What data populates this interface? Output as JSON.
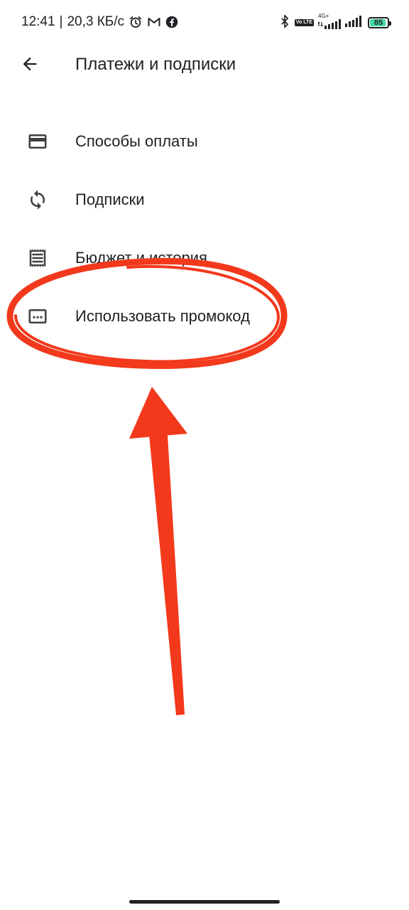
{
  "status_bar": {
    "time": "12:41",
    "separator": "|",
    "net_speed": "20,3 КБ/с",
    "network_type": "4G+",
    "volte": "Vo LTE",
    "battery_level": "85",
    "icons_left": [
      "alarm-icon",
      "gmail-icon",
      "facebook-icon"
    ],
    "icons_right": [
      "bluetooth-icon",
      "volte-icon",
      "signal-icon",
      "signal-icon"
    ]
  },
  "app_bar": {
    "back_icon": "arrow-back-icon",
    "title": "Платежи и подписки"
  },
  "menu": {
    "items": [
      {
        "icon": "credit-card-icon",
        "label": "Способы оплаты"
      },
      {
        "icon": "sync-icon",
        "label": "Подписки"
      },
      {
        "icon": "receipt-icon",
        "label": "Бюджет и история"
      },
      {
        "icon": "promo-code-icon",
        "label": "Использовать промокод"
      }
    ]
  },
  "annotation": {
    "color": "#f2391c",
    "shapes": [
      "ellipse",
      "arrow"
    ]
  },
  "colors": {
    "text": "#202124",
    "background": "#ffffff",
    "battery_fill": "#43d9a0"
  }
}
